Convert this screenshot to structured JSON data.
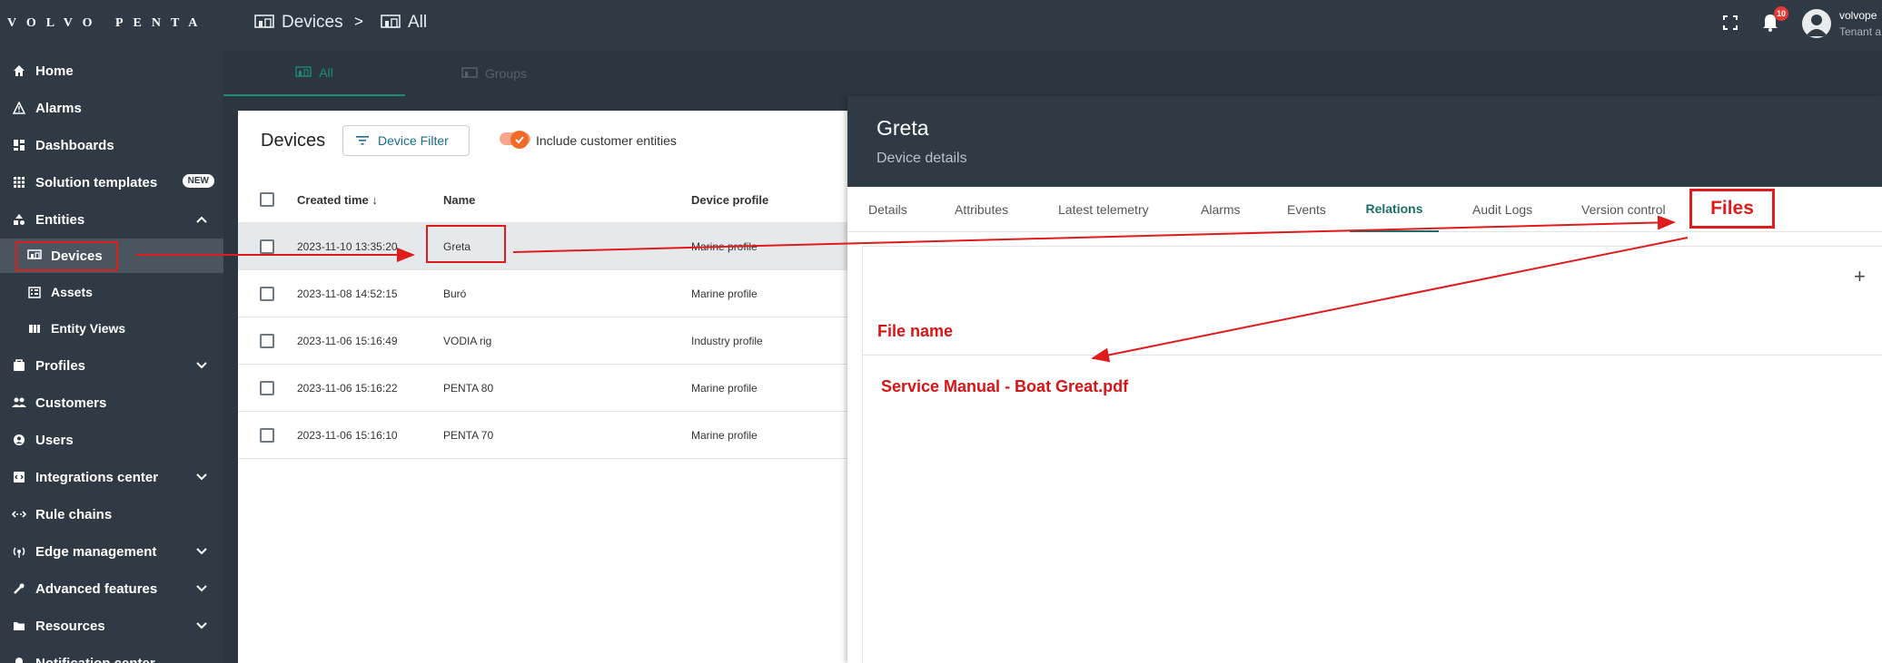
{
  "brand": {
    "logo_text": "VOLVO PENTA"
  },
  "sidebar": {
    "items": [
      {
        "label": "Home",
        "icon": "home-icon"
      },
      {
        "label": "Alarms",
        "icon": "alarm-icon"
      },
      {
        "label": "Dashboards",
        "icon": "dashboard-icon"
      },
      {
        "label": "Solution templates",
        "icon": "grid-icon",
        "badge": "NEW"
      },
      {
        "label": "Entities",
        "icon": "entities-icon"
      },
      {
        "label": "Devices",
        "icon": "devices-icon"
      },
      {
        "label": "Assets",
        "icon": "assets-icon"
      },
      {
        "label": "Entity Views",
        "icon": "entity-views-icon"
      },
      {
        "label": "Profiles",
        "icon": "profiles-icon"
      },
      {
        "label": "Customers",
        "icon": "customers-icon"
      },
      {
        "label": "Users",
        "icon": "users-icon"
      },
      {
        "label": "Integrations center",
        "icon": "integrations-icon"
      },
      {
        "label": "Rule chains",
        "icon": "rule-chains-icon"
      },
      {
        "label": "Edge management",
        "icon": "edge-icon"
      },
      {
        "label": "Advanced features",
        "icon": "tools-icon"
      },
      {
        "label": "Resources",
        "icon": "folder-icon"
      },
      {
        "label": "Notification center",
        "icon": "notification-icon"
      }
    ]
  },
  "topbar": {
    "breadcrumb": [
      "Devices",
      "All"
    ],
    "separator": ">",
    "notifications_count": "10",
    "user_name": "volvope",
    "user_role": "Tenant a"
  },
  "main_tabs": [
    "All",
    "Groups"
  ],
  "devices": {
    "title": "Devices",
    "filter_label": "Device Filter",
    "toggle_label": "Include customer entities",
    "columns": [
      "Created time",
      "Name",
      "Device profile"
    ],
    "rows": [
      {
        "created": "2023-11-10 13:35:20",
        "name": "Greta",
        "profile": "Marine profile"
      },
      {
        "created": "2023-11-08 14:52:15",
        "name": "Buró",
        "profile": "Marine profile"
      },
      {
        "created": "2023-11-06 15:16:49",
        "name": "VODIA rig",
        "profile": "Industry profile"
      },
      {
        "created": "2023-11-06 15:16:22",
        "name": "PENTA 80",
        "profile": "Marine profile"
      },
      {
        "created": "2023-11-06 15:16:10",
        "name": "PENTA 70",
        "profile": "Marine profile"
      }
    ]
  },
  "details": {
    "title": "Greta",
    "subtitle": "Device details",
    "tabs": [
      "Details",
      "Attributes",
      "Latest telemetry",
      "Alarms",
      "Events",
      "Relations",
      "Audit Logs",
      "Version control",
      "Files"
    ],
    "add_symbol": "+",
    "file_column_label": "File name",
    "file_entry": "Service Manual - Boat Great.pdf"
  },
  "colors": {
    "accent": "#1b6e6a",
    "annotation": "#e01b1b",
    "sidebar_bg": "#2f3a44"
  }
}
